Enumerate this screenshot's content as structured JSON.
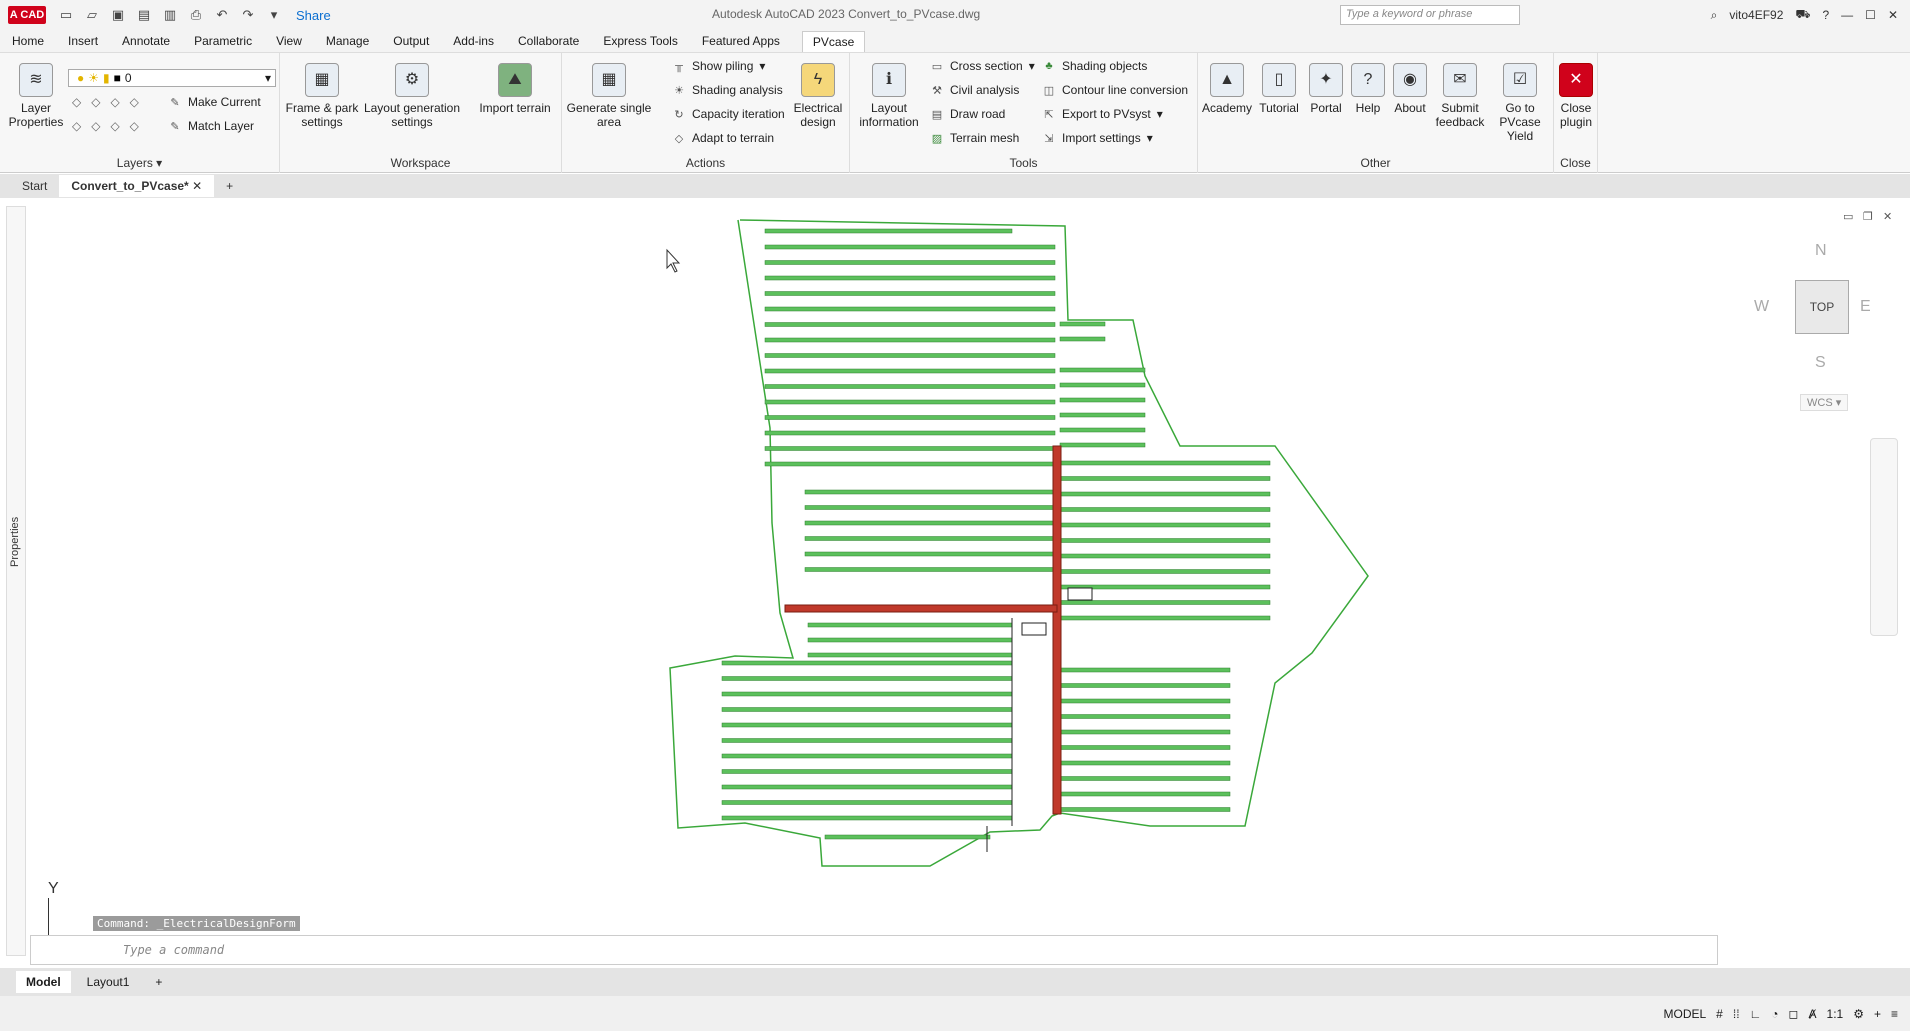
{
  "app": {
    "logo": "A CAD",
    "title": "Autodesk AutoCAD 2023   Convert_to_PVcase.dwg",
    "share": "Share",
    "search_placeholder": "Type a keyword or phrase",
    "user": "vito4EF92"
  },
  "menu": [
    "Home",
    "Insert",
    "Annotate",
    "Parametric",
    "View",
    "Manage",
    "Output",
    "Add-ins",
    "Collaborate",
    "Express Tools",
    "Featured Apps",
    "PVcase"
  ],
  "ribbon": {
    "layers": {
      "title": "Layers",
      "layer_properties": "Layer Properties",
      "current_layer": "0",
      "make_current": "Make Current",
      "match_layer": "Match Layer"
    },
    "workspace": {
      "title": "Workspace",
      "frame_park": "Frame & park settings",
      "layout_gen": "Layout generation settings",
      "import_terrain": "Import terrain"
    },
    "actions": {
      "title": "Actions",
      "gen_single": "Generate single area",
      "show_piling": "Show piling",
      "shading_analysis": "Shading analysis",
      "capacity_iteration": "Capacity iteration",
      "adapt_terrain": "Adapt to terrain",
      "electrical_design": "Electrical design"
    },
    "tools": {
      "title": "Tools",
      "layout_info": "Layout information",
      "cross_section": "Cross section",
      "civil_analysis": "Civil analysis",
      "draw_road": "Draw road",
      "terrain_mesh": "Terrain mesh",
      "shading_objects": "Shading objects",
      "contour_line": "Contour line conversion",
      "export_pvsyst": "Export to PVsyst",
      "import_settings": "Import settings"
    },
    "other": {
      "title": "Other",
      "academy": "Academy",
      "tutorial": "Tutorial",
      "portal": "Portal",
      "help": "Help",
      "about": "About",
      "feedback": "Submit feedback",
      "yield": "Go to PVcase Yield"
    },
    "close": {
      "title": "Close",
      "close_plugin": "Close plugin"
    }
  },
  "doc_tabs": {
    "start": "Start",
    "active": "Convert_to_PVcase*"
  },
  "side_panel": "Properties",
  "viewcube": {
    "face": "TOP",
    "n": "N",
    "s": "S",
    "e": "E",
    "w": "W",
    "wcs": "WCS"
  },
  "command": {
    "history": "Command: _ElectricalDesignForm",
    "placeholder": "Type a command"
  },
  "layout_tabs": [
    "Model",
    "Layout1"
  ],
  "status": {
    "model": "MODEL",
    "scale": "1:1"
  },
  "ucs_label": "Y"
}
